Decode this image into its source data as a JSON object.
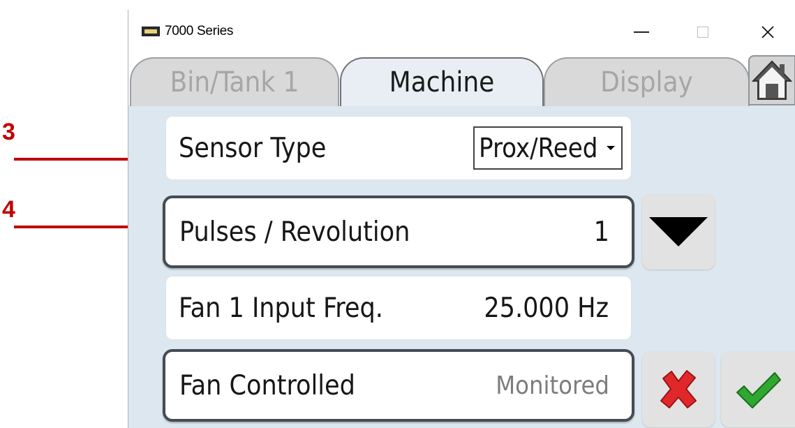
{
  "annotations": [
    {
      "label": "3"
    },
    {
      "label": "4"
    }
  ],
  "window": {
    "title": "7000 Series",
    "controls": {
      "minimize": "minimize",
      "maximize": "maximize",
      "close": "close"
    }
  },
  "tabs": [
    {
      "label": "Bin/Tank 1",
      "active": false
    },
    {
      "label": "Machine",
      "active": true
    },
    {
      "label": "Display",
      "active": false
    }
  ],
  "home_icon": "home-icon",
  "rows": {
    "sensor_type": {
      "label": "Sensor Type",
      "value": "Prox/Reed"
    },
    "pulses_per_rev": {
      "label": "Pulses / Revolution",
      "value": "1"
    },
    "fan_input_freq": {
      "label": "Fan 1 Input Freq.",
      "value": "25.000 Hz"
    },
    "fan_controlled": {
      "label": "Fan Controlled",
      "value": "Monitored"
    }
  },
  "icons": {
    "down": "triangle-down-icon",
    "cancel": "red-x-icon",
    "confirm": "green-check-icon"
  },
  "colors": {
    "annotation": "#c00000",
    "background": "#dde7ef",
    "cancel": "#e0282b",
    "confirm": "#2fa82f"
  }
}
